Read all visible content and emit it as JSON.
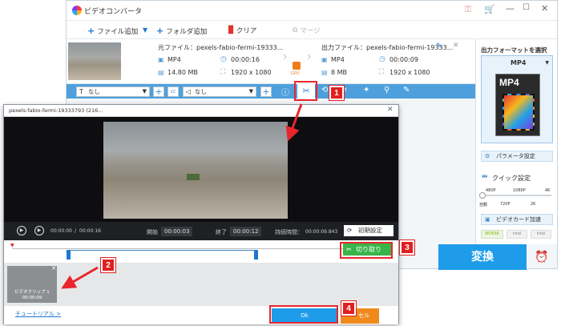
{
  "main": {
    "title": "ビデオコンバータ",
    "toolbar": {
      "add_file": "ファイル追加",
      "add_folder": "フォルダ追加",
      "clear": "クリア",
      "merge": "マージ"
    },
    "file": {
      "source": "元ファイル：pexels-fabio-fermi-19333...",
      "output": "出力ファイル：pexels-fabio-fermi-19333...",
      "src_format": "MP4",
      "src_duration": "00:00:16",
      "src_size": "14.80 MB",
      "src_res": "1920 x 1080",
      "out_format": "MP4",
      "out_duration": "00:00:09",
      "out_size": "8 MB",
      "out_res": "1920 x 1080",
      "gpu_label": "GPU"
    },
    "bar": {
      "subtitle_select": "なし",
      "audio_select": "なし"
    },
    "right_panel": {
      "heading": "出力フォーマットを選択",
      "format": "MP4",
      "format_icon_text": "MP4",
      "params": "パラメータ設定",
      "quick": "クイック設定",
      "res_top": [
        "480P",
        "1080P",
        "4K"
      ],
      "res_bottom": [
        "自動",
        "720P",
        "2K"
      ],
      "gpu_accel": "ビデオカード加速",
      "vendors": [
        "NVIDIA",
        "intel",
        "Intel"
      ]
    },
    "convert": "変換"
  },
  "dialog": {
    "title": "pexels-fabio-fermi-19333793 (216...",
    "time_current": "00:00:00",
    "time_sep": "/",
    "time_total": "00:00:16",
    "start_label": "開始",
    "start_value": "00:00:03",
    "end_label": "終了",
    "end_value": "00:00:12",
    "duration_label": "持続時間：",
    "duration_value": "00:00:09.843",
    "reset": "初期設定",
    "cut": "切り取り",
    "clip_name": "ビデオクリップ 1",
    "clip_time": "00:00:09",
    "tutorial": "チュートリアル >",
    "ok": "Ok",
    "cancel_partial": "セル"
  },
  "badges": [
    "1",
    "2",
    "3",
    "4"
  ],
  "colors": {
    "accent_blue": "#1e9cea",
    "badge_red": "#e02020",
    "cut_green": "#38b548",
    "cancel_orange": "#f08a1d"
  }
}
